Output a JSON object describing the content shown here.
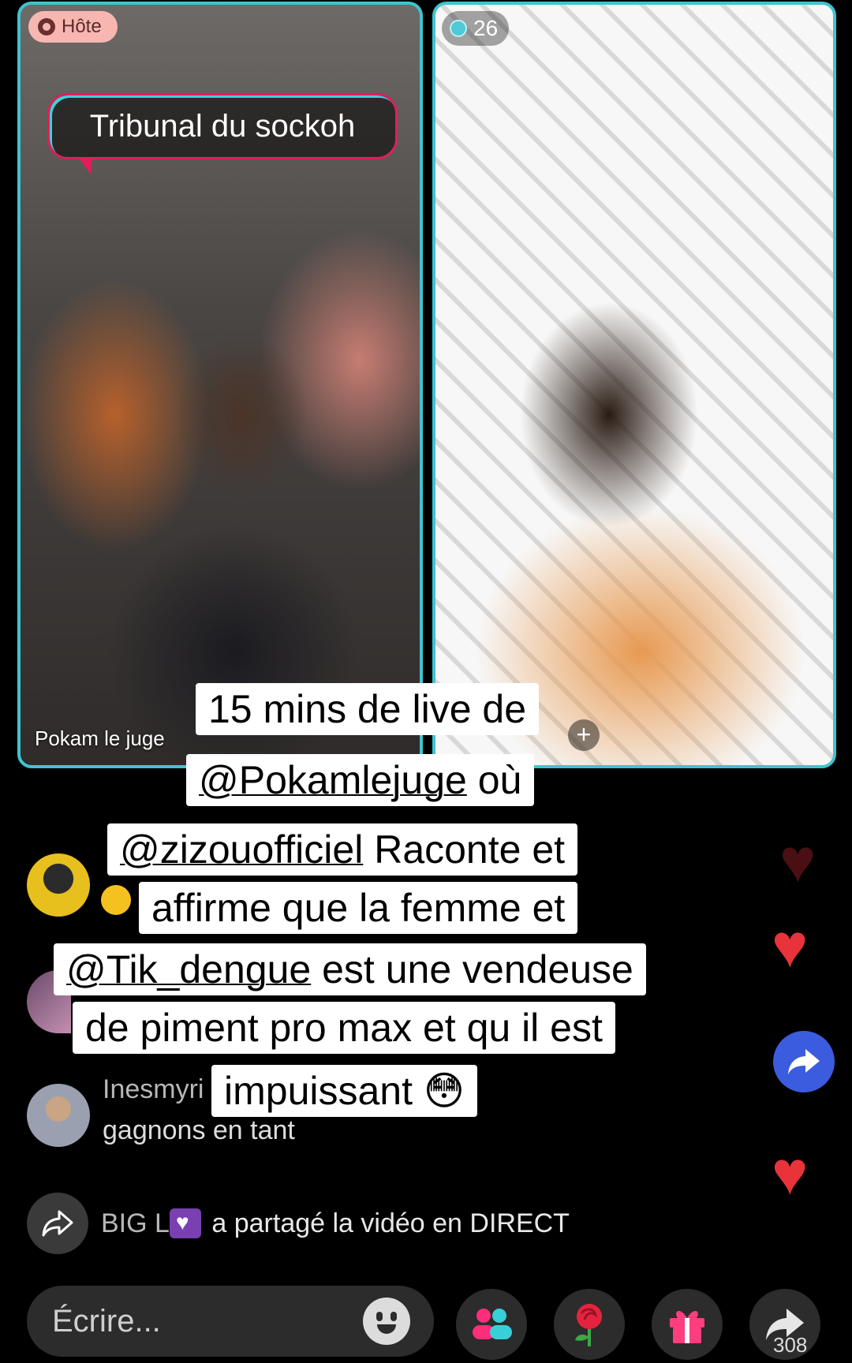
{
  "left_tile": {
    "host_label": "Hôte",
    "title": "Tribunal du sockoh",
    "name": "Pokam le juge"
  },
  "right_tile": {
    "viewer_count": "26",
    "add_label": "+"
  },
  "caption": {
    "line1": "15 mins de live de",
    "line2_mention": "@Pokamlejuge",
    "line2_rest": " où",
    "line3_mention": "@zizouofficiel",
    "line3_rest": " Raconte et",
    "line4": "affirme que la femme et",
    "line5_mention": "@Tik_dengue",
    "line5_rest": " est une vendeuse",
    "line6": "de piment pro max et qu il est",
    "line7": "impuissant 😳"
  },
  "comments": {
    "c3_name": "Inesmyri",
    "c3_text": "gagnons en tant"
  },
  "share_event": {
    "user": "BIG L",
    "text": " a partagé la vidéo en DIRECT"
  },
  "bottom_bar": {
    "placeholder": "Écrire...",
    "share_count": "308"
  },
  "colors": {
    "tile_border": "#3fc4cf",
    "heart": "#e8333a",
    "share_fab": "#3b5cde"
  }
}
